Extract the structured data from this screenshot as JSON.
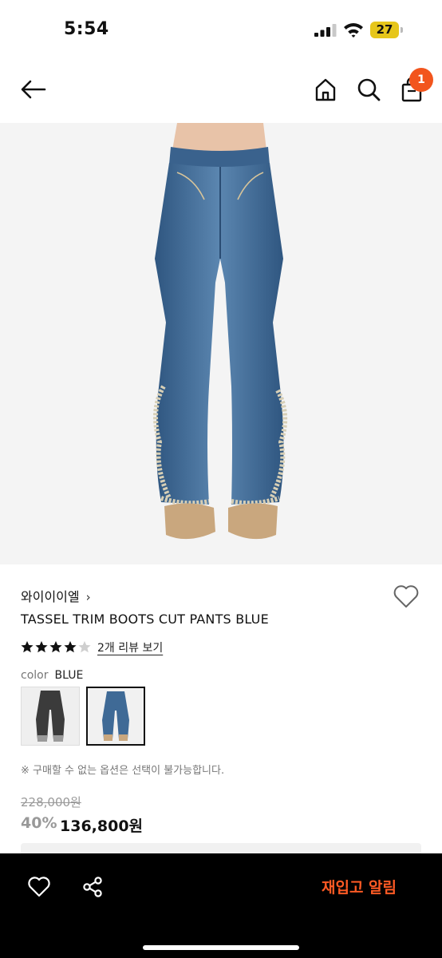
{
  "status_bar": {
    "time": "5:54",
    "battery": "27"
  },
  "nav": {
    "cart_count": "1"
  },
  "product": {
    "brand": "와이이이엘",
    "brand_chevron": "›",
    "name": "TASSEL TRIM BOOTS CUT PANTS BLUE",
    "rating": 4.5,
    "review_link": "2개 리뷰 보기",
    "color_label": "color",
    "color_value": "BLUE",
    "notice": "※ 구매할 수 없는 옵션은 선택이 불가능합니다.",
    "original_price": "228,000원",
    "discount": "40%",
    "sale_price": "136,800원"
  },
  "bottom_bar": {
    "restock_button": "재입고 알림"
  },
  "colors": {
    "accent": "#f2551d",
    "restock": "#ff5a24",
    "denim": "#3f6a96"
  }
}
